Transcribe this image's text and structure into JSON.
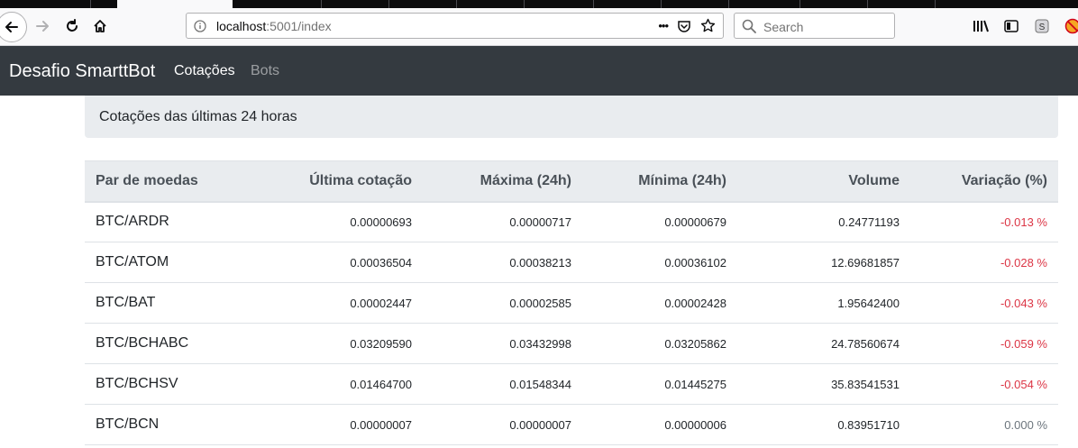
{
  "browser": {
    "url_host": "localhost",
    "url_rest": ":5001/index",
    "search_placeholder": "Search",
    "page_actions_label": "•••"
  },
  "navbar": {
    "brand": "Desafio SmarttBot",
    "links": [
      {
        "label": "Cotações",
        "active": true
      },
      {
        "label": "Bots",
        "active": false
      }
    ]
  },
  "heading": "Cotações das últimas 24 horas",
  "table": {
    "headers": [
      "Par de moedas",
      "Última cotação",
      "Máxima (24h)",
      "Mínima (24h)",
      "Volume",
      "Variação (%)"
    ],
    "rows": [
      {
        "pair": "BTC/ARDR",
        "last": "0.00000693",
        "high": "0.00000717",
        "low": "0.00000679",
        "volume": "0.24771193",
        "change": "-0.013 %"
      },
      {
        "pair": "BTC/ATOM",
        "last": "0.00036504",
        "high": "0.00038213",
        "low": "0.00036102",
        "volume": "12.69681857",
        "change": "-0.028 %"
      },
      {
        "pair": "BTC/BAT",
        "last": "0.00002447",
        "high": "0.00002585",
        "low": "0.00002428",
        "volume": "1.95642400",
        "change": "-0.043 %"
      },
      {
        "pair": "BTC/BCHABC",
        "last": "0.03209590",
        "high": "0.03432998",
        "low": "0.03205862",
        "volume": "24.78560674",
        "change": "-0.059 %"
      },
      {
        "pair": "BTC/BCHSV",
        "last": "0.01464700",
        "high": "0.01548344",
        "low": "0.01445275",
        "volume": "35.83541531",
        "change": "-0.054 %"
      },
      {
        "pair": "BTC/BCN",
        "last": "0.00000007",
        "high": "0.00000007",
        "low": "0.00000006",
        "volume": "0.83951710",
        "change": "0.000 %"
      }
    ]
  },
  "colors": {
    "navbar_bg": "#343a40",
    "negative": "#dc3545",
    "neutral": "#6c757d",
    "heading_bg": "#e9ecef"
  }
}
